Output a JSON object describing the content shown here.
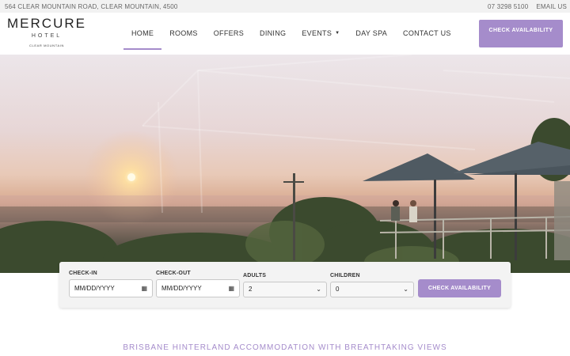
{
  "topbar": {
    "address": "564 CLEAR MOUNTAIN ROAD, CLEAR MOUNTAIN, 4500",
    "phone": "07 3298 5100",
    "email": "EMAIL US"
  },
  "logo": {
    "brand": "MERCURE",
    "sub": "HOTEL",
    "location": "CLEAR MOUNTAIN"
  },
  "nav": {
    "items": [
      {
        "label": "HOME",
        "active": true
      },
      {
        "label": "ROOMS"
      },
      {
        "label": "OFFERS"
      },
      {
        "label": "DINING"
      },
      {
        "label": "EVENTS",
        "dropdown": true
      },
      {
        "label": "DAY SPA"
      },
      {
        "label": "CONTACT US"
      }
    ],
    "cta": "CHECK AVAILABILITY"
  },
  "booking": {
    "checkin": {
      "label": "CHECK-IN",
      "placeholder": "MM/DD/YYYY"
    },
    "checkout": {
      "label": "CHECK-OUT",
      "placeholder": "MM/DD/YYYY"
    },
    "adults": {
      "label": "ADULTS",
      "value": "2"
    },
    "children": {
      "label": "CHILDREN",
      "value": "0"
    },
    "submit": "CHECK AVAILABILITY"
  },
  "tagline": "BRISBANE HINTERLAND ACCOMMODATION WITH BREATHTAKING VIEWS",
  "colors": {
    "accent": "#a58ccb",
    "topbar_bg": "#f2f2f2"
  }
}
